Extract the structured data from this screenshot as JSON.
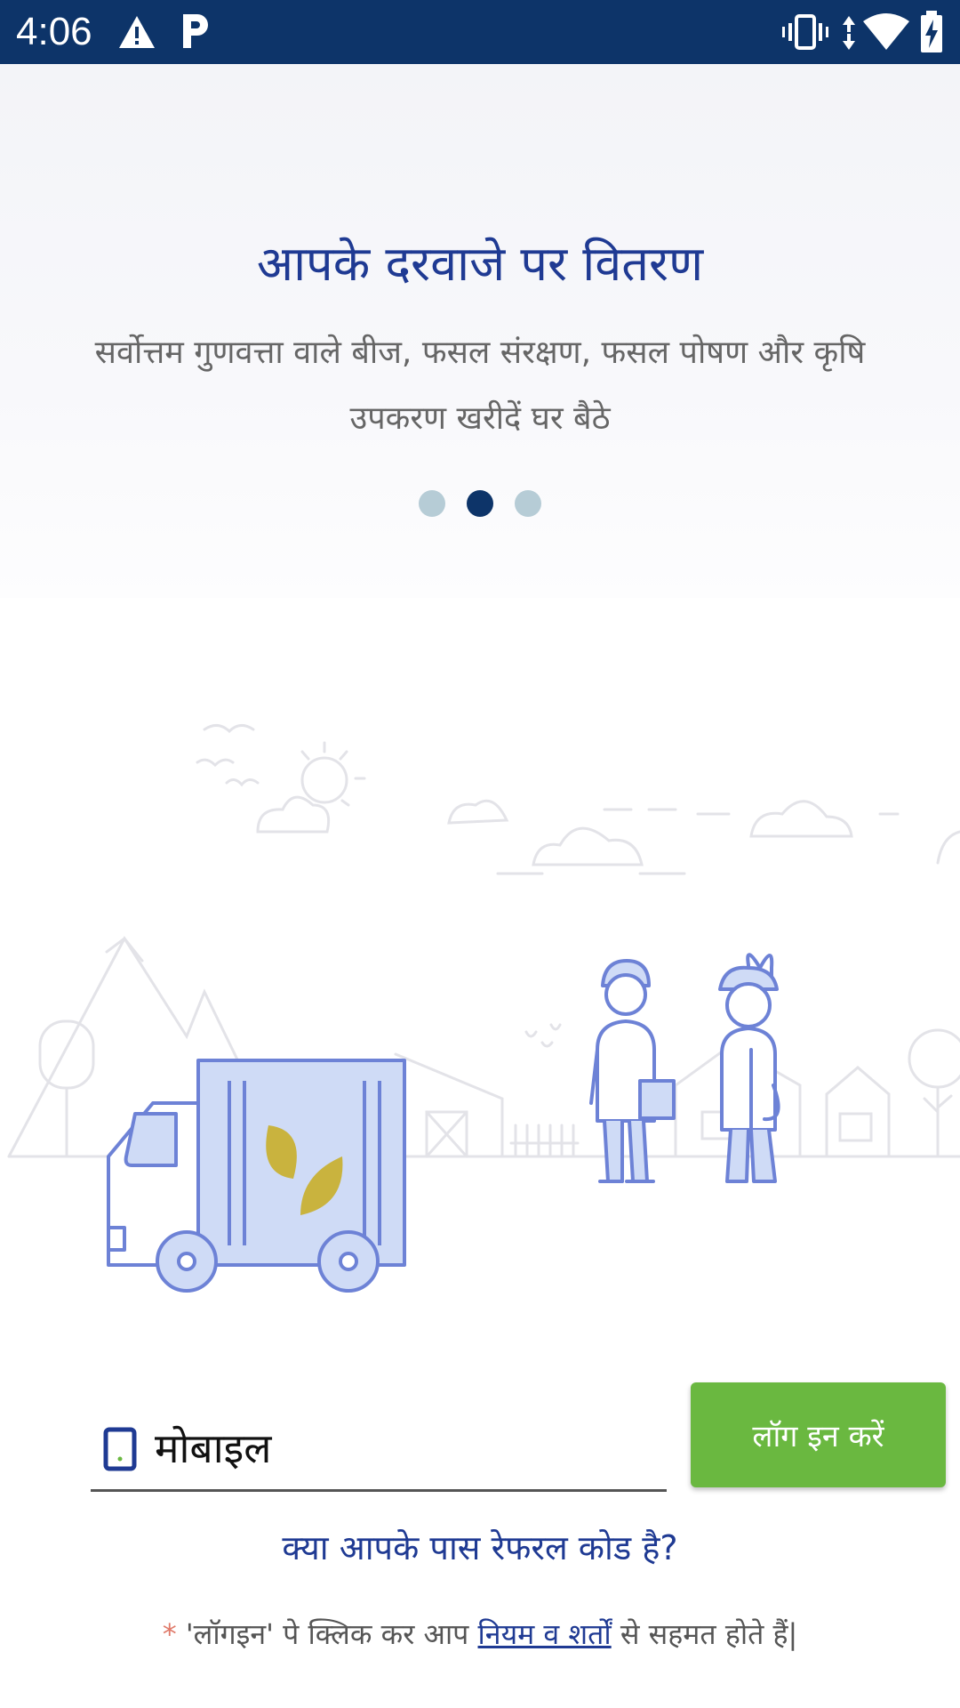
{
  "status_bar": {
    "time": "4:06",
    "icons": [
      "warning-icon",
      "parking-app-icon",
      "vibrate-icon",
      "data-arrows-icon",
      "wifi-icon",
      "battery-charging-icon"
    ]
  },
  "onboarding": {
    "title": "आपके दरवाजे पर वितरण",
    "subtitle": "सर्वोत्तम गुणवत्ता वाले बीज, फसल संरक्षण, फसल पोषण और कृषि उपकरण खरीदें घर बैठे",
    "pager": {
      "count": 3,
      "active_index": 1
    }
  },
  "login": {
    "mobile_placeholder": "मोबाइल",
    "login_button": "लॉग इन करें",
    "referral_link": "क्या आपके पास रेफरल कोड है?",
    "terms_star": "*",
    "terms_prefix": "'लॉगइन' पे क्लिक कर आप",
    "terms_link": "नियम व शर्तों",
    "terms_suffix": "से सहमत होते हैं|"
  },
  "colors": {
    "status_bar": "#0d3469",
    "title_blue": "#1f3a93",
    "login_green": "#6ab840",
    "dot_inactive": "#b6ccd6",
    "dot_active": "#0d3469"
  }
}
